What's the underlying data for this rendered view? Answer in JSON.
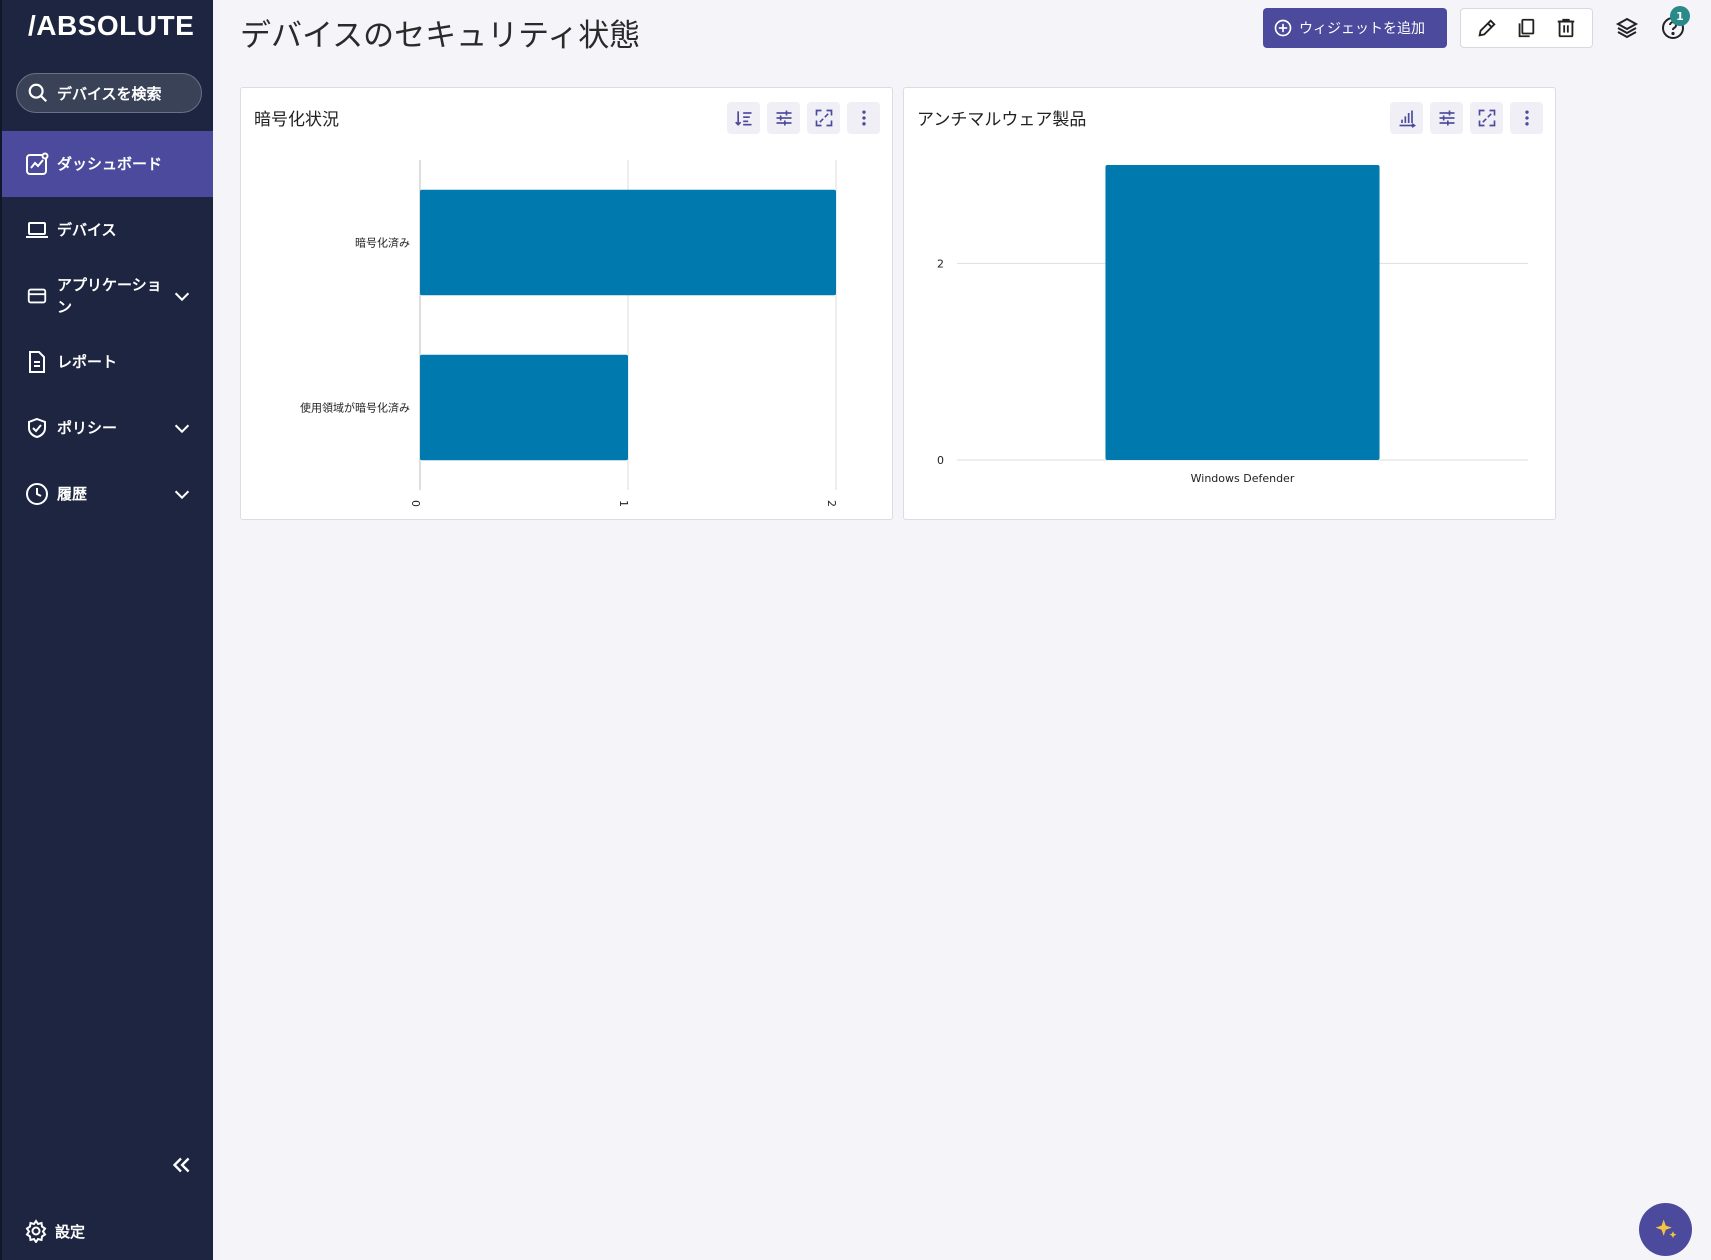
{
  "app": {
    "logo_text": "/ABSOLUTE"
  },
  "search": {
    "placeholder": "デバイスを検索"
  },
  "sidebar": {
    "items": [
      {
        "label": "ダッシュボード",
        "icon": "dashboard-icon",
        "active": true
      },
      {
        "label": "デバイス",
        "icon": "laptop-icon"
      },
      {
        "label": "アプリケーション",
        "icon": "application-window-icon",
        "expandable": true
      },
      {
        "label": "レポート",
        "icon": "report-document-icon"
      },
      {
        "label": "ポリシー",
        "icon": "shield-check-icon",
        "expandable": true
      },
      {
        "label": "履歴",
        "icon": "clock-icon",
        "expandable": true
      }
    ],
    "settings_label": "設定"
  },
  "header": {
    "title": "デバイスのセキュリティ状態",
    "add_widget_label": "ウィジェットを追加",
    "notification_count": "1"
  },
  "colors": {
    "accent": "#4c4a9c",
    "sidebar": "#1d2540",
    "bar": "#007aae",
    "badge": "#2a8a8a"
  },
  "widgets": [
    {
      "title": "暗号化状況",
      "chart_data": {
        "type": "bar",
        "orientation": "horizontal",
        "categories": [
          "暗号化済み",
          "使用領域が暗号化済み"
        ],
        "values": [
          2,
          1
        ],
        "xticks": [
          "0",
          "1",
          "2"
        ],
        "xlim": [
          0,
          2
        ],
        "grid": true
      }
    },
    {
      "title": "アンチマルウェア製品",
      "chart_data": {
        "type": "bar",
        "orientation": "vertical",
        "categories": [
          "Windows Defender"
        ],
        "values": [
          3
        ],
        "yticks": [
          "0",
          "2"
        ],
        "ylim": [
          0,
          3
        ],
        "grid": true
      }
    }
  ]
}
